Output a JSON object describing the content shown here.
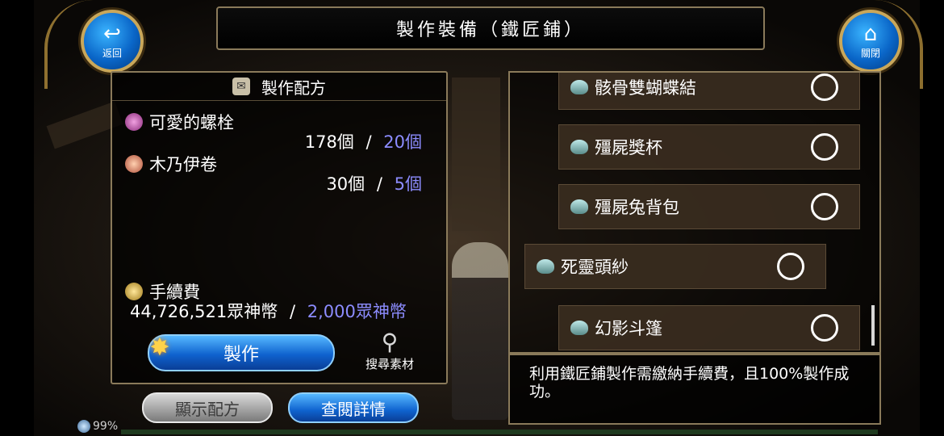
{
  "title": "製作裝備（鐵匠鋪）",
  "nav": {
    "back_label": "返回",
    "close_label": "關閉"
  },
  "recipe": {
    "header": "製作配方",
    "materials": [
      {
        "name": "可愛的螺栓",
        "have": "178個",
        "sep": "/",
        "need": "20個",
        "icon_color": "#c24aa8"
      },
      {
        "name": "木乃伊卷",
        "have": "30個",
        "sep": "/",
        "need": "5個",
        "icon_color": "#e07a5a"
      }
    ],
    "fee_label": "手續費",
    "fee_have": "44,726,521眾神幣",
    "fee_sep": "/",
    "fee_need": "2,000眾神幣",
    "make_label": "製作",
    "search_label": "搜尋素材"
  },
  "buttons": {
    "show_recipe": "顯示配方",
    "view_details": "查閱詳情"
  },
  "list": {
    "items": [
      {
        "name": "骸骨雙蝴蝶結"
      },
      {
        "name": "殭屍獎杯"
      },
      {
        "name": "殭屍兔背包"
      },
      {
        "name": "死靈頭紗"
      },
      {
        "name": "幻影斗篷"
      }
    ]
  },
  "description": "利用鐵匠鋪製作需繳納手續費，且100%製作成功。",
  "status": {
    "battery": "99%"
  },
  "colors": {
    "required_text": "#8c8cff",
    "frame_gold": "#8a7a5a",
    "primary_button": "#0f63cf"
  }
}
